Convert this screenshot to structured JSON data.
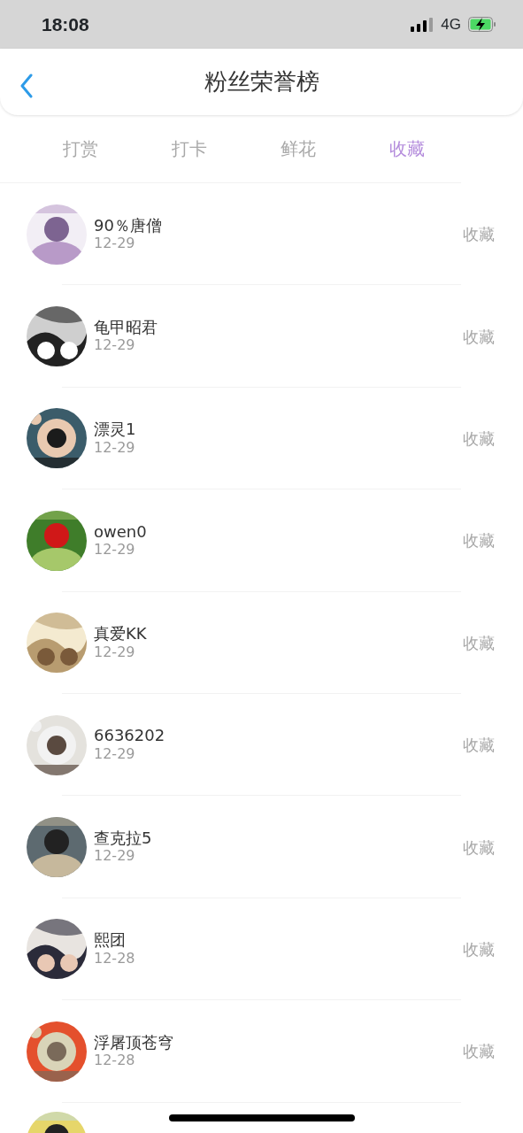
{
  "status_bar": {
    "time": "18:08",
    "network": "4G"
  },
  "header": {
    "title": "粉丝荣誉榜"
  },
  "tabs": [
    {
      "label": "打赏",
      "selected": false
    },
    {
      "label": "打卡",
      "selected": false
    },
    {
      "label": "鲜花",
      "selected": false
    },
    {
      "label": "收藏",
      "selected": true
    }
  ],
  "fans": [
    {
      "kind": "full",
      "name": "90％唐僧",
      "date": "12-29",
      "action": "收藏"
    },
    {
      "kind": "full",
      "name": "龟甲昭君",
      "date": "12-29",
      "action": "收藏"
    },
    {
      "kind": "full",
      "name": "漂灵1",
      "date": "12-29",
      "action": "收藏"
    },
    {
      "kind": "full",
      "name": "owen0",
      "date": "12-29",
      "action": "收藏"
    },
    {
      "kind": "full",
      "name": "真爱KK",
      "date": "12-29",
      "action": "收藏"
    },
    {
      "kind": "full",
      "name": "6636202",
      "date": "12-29",
      "action": "收藏"
    },
    {
      "kind": "full",
      "name": "查克拉5",
      "date": "12-29",
      "action": "收藏"
    },
    {
      "kind": "full",
      "name": "熙团",
      "date": "12-28",
      "action": "收藏"
    },
    {
      "kind": "full",
      "name": "浮屠顶苍穹",
      "date": "12-28",
      "action": "收藏"
    },
    {
      "kind": "cut"
    }
  ]
}
